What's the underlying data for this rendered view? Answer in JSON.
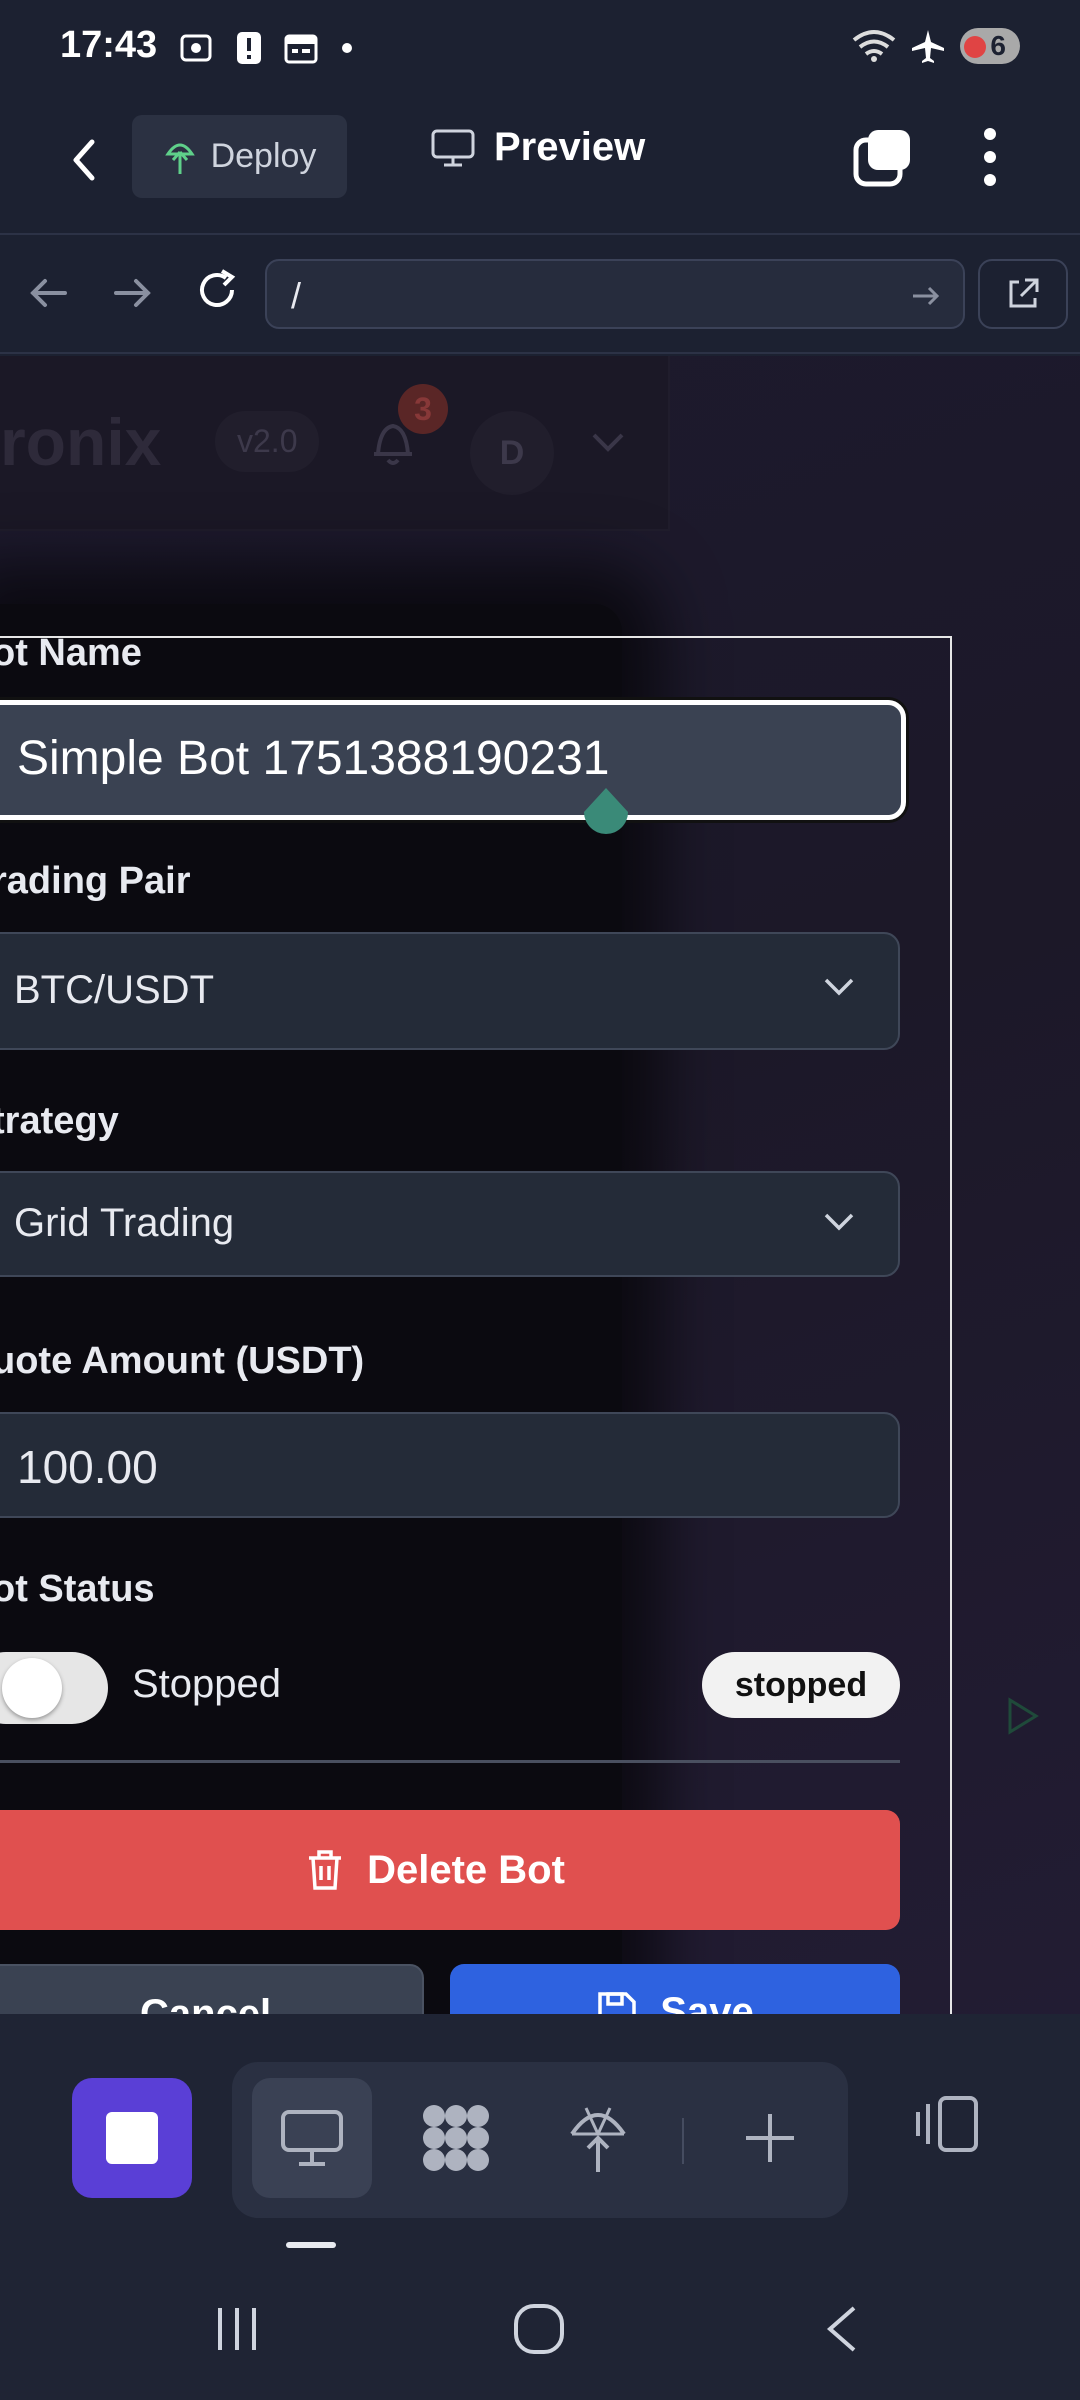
{
  "status_bar": {
    "time": "17:43",
    "battery": "6",
    "icons": [
      "screenshot-icon",
      "alert-icon",
      "calendar-icon",
      "dot-icon",
      "wifi-icon",
      "airplane-icon",
      "battery-icon"
    ]
  },
  "app_bar": {
    "deploy_label": "Deploy",
    "preview_label": "Preview"
  },
  "url_bar": {
    "url": "/"
  },
  "site_header": {
    "brand": "ronix",
    "version": "v2.0",
    "notifications": "3",
    "avatar_initial": "D"
  },
  "form": {
    "bot_name_label": "ot Name",
    "bot_name_value": "Simple Bot 1751388190231",
    "trading_pair_label": "rading Pair",
    "trading_pair_value": "BTC/USDT",
    "strategy_label": "trategy",
    "strategy_value": "Grid Trading",
    "quote_amount_label": "uote Amount (USDT)",
    "quote_amount_value": "100.00",
    "bot_status_label": "ot Status",
    "toggle_label": "Stopped",
    "status_badge": "stopped",
    "delete_label": "Delete Bot",
    "cancel_label": "Cancel",
    "save_label": "Save"
  },
  "colors": {
    "accent_purple": "#5a3fd6",
    "delete_red": "#e0504f",
    "save_blue": "#2e62e0",
    "teal_handle": "#3a8a78"
  }
}
